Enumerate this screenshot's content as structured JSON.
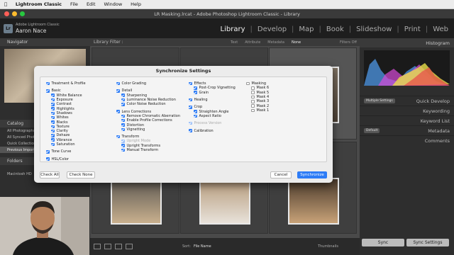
{
  "menubar": {
    "apple": "",
    "items": [
      "Lightroom Classic",
      "File",
      "Edit",
      "Window",
      "Help"
    ]
  },
  "window": {
    "title": "LR Masking.lrcat - Adobe Photoshop Lightroom Classic - Library"
  },
  "identity": {
    "product": "Adobe Lightroom Classic",
    "name": "Aaron Nace"
  },
  "modules": [
    "Library",
    "Develop",
    "Map",
    "Book",
    "Slideshow",
    "Print",
    "Web"
  ],
  "left_panel": {
    "navigator": "Navigator",
    "catalog": "Catalog",
    "catalog_items": [
      "All Photographs",
      "All Synced Photographs",
      "Quick Collection +",
      "Previous Import"
    ],
    "folders": "Folders",
    "drive": "Macintosh HD"
  },
  "filter_bar": {
    "label": "Library Filter :",
    "options": [
      "Text",
      "Attribute",
      "Metadata",
      "None"
    ],
    "filters_off": "Filters Off"
  },
  "right_panel": {
    "histogram": "Histogram",
    "preset": "Multiple Settings",
    "quick_develop": "Quick Develop",
    "keywording": "Keywording",
    "keyword_list": "Keyword List",
    "default": "Default",
    "metadata": "Metadata",
    "comments": "Comments"
  },
  "bottom": {
    "sort_label": "Sort:",
    "sort_value": "File Name",
    "thumbnails": "Thumbnails",
    "sync": "Sync",
    "sync_settings": "Sync Settings"
  },
  "dialog": {
    "title": "Synchronize Settings",
    "col1": [
      {
        "label": "Treatment & Profile",
        "on": true,
        "lvl": 0
      },
      {
        "gap": true
      },
      {
        "label": "Basic",
        "on": true,
        "lvl": 0
      },
      {
        "label": "White Balance",
        "on": true,
        "lvl": 1
      },
      {
        "label": "Exposure",
        "on": true,
        "lvl": 1
      },
      {
        "label": "Contrast",
        "on": true,
        "lvl": 1
      },
      {
        "label": "Highlights",
        "on": true,
        "lvl": 1
      },
      {
        "label": "Shadows",
        "on": true,
        "lvl": 1
      },
      {
        "label": "Whites",
        "on": true,
        "lvl": 1
      },
      {
        "label": "Blacks",
        "on": true,
        "lvl": 1
      },
      {
        "label": "Texture",
        "on": true,
        "lvl": 1
      },
      {
        "label": "Clarity",
        "on": true,
        "lvl": 1
      },
      {
        "label": "Dehaze",
        "on": true,
        "lvl": 1
      },
      {
        "label": "Vibrance",
        "on": true,
        "lvl": 1
      },
      {
        "label": "Saturation",
        "on": true,
        "lvl": 1
      },
      {
        "gap": true
      },
      {
        "label": "Tone Curve",
        "on": true,
        "lvl": 0
      },
      {
        "gap": true
      },
      {
        "label": "HSL/Color",
        "on": true,
        "lvl": 0
      }
    ],
    "col2": [
      {
        "label": "Color Grading",
        "on": true,
        "lvl": 0
      },
      {
        "gap": true
      },
      {
        "label": "Detail",
        "on": true,
        "lvl": 0
      },
      {
        "label": "Sharpening",
        "on": true,
        "lvl": 1
      },
      {
        "label": "Luminance Noise Reduction",
        "on": true,
        "lvl": 1
      },
      {
        "label": "Color Noise Reduction",
        "on": true,
        "lvl": 1
      },
      {
        "gap": true
      },
      {
        "label": "Lens Corrections",
        "on": true,
        "lvl": 0
      },
      {
        "label": "Remove Chromatic Aberration",
        "on": true,
        "lvl": 1
      },
      {
        "label": "Enable Profile Corrections",
        "on": true,
        "lvl": 1
      },
      {
        "label": "Distortion",
        "on": true,
        "lvl": 1
      },
      {
        "label": "Vignetting",
        "on": true,
        "lvl": 1
      },
      {
        "gap": true
      },
      {
        "label": "Transform",
        "on": true,
        "lvl": 0
      },
      {
        "label": "Upright Mode",
        "on": true,
        "lvl": 1,
        "dim": true
      },
      {
        "label": "Upright Transforms",
        "on": true,
        "lvl": 1
      },
      {
        "label": "Manual Transform",
        "on": true,
        "lvl": 1
      }
    ],
    "col3": [
      {
        "label": "Effects",
        "on": true,
        "lvl": 0
      },
      {
        "label": "Post-Crop Vignetting",
        "on": true,
        "lvl": 1
      },
      {
        "label": "Grain",
        "on": true,
        "lvl": 1
      },
      {
        "gap": true
      },
      {
        "label": "Healing",
        "on": true,
        "lvl": 0
      },
      {
        "gap": true
      },
      {
        "label": "Crop",
        "on": true,
        "lvl": 0
      },
      {
        "label": "Straighten Angle",
        "on": true,
        "lvl": 1
      },
      {
        "label": "Aspect Ratio",
        "on": true,
        "lvl": 1
      },
      {
        "gap": true
      },
      {
        "label": "Process Version",
        "on": true,
        "lvl": 0,
        "dim": true
      },
      {
        "gap": true
      },
      {
        "label": "Calibration",
        "on": true,
        "lvl": 0
      }
    ],
    "col4": [
      {
        "label": "Masking",
        "on": false,
        "lvl": 0
      },
      {
        "label": "Mask 6",
        "on": false,
        "lvl": 1
      },
      {
        "label": "Mask 5",
        "on": false,
        "lvl": 1
      },
      {
        "label": "Mask 4",
        "on": false,
        "lvl": 1
      },
      {
        "label": "Mask 3",
        "on": false,
        "lvl": 1
      },
      {
        "label": "Mask 2",
        "on": false,
        "lvl": 1
      },
      {
        "label": "Mask 1",
        "on": false,
        "lvl": 1
      }
    ],
    "buttons": {
      "check_all": "Check All",
      "check_none": "Check None",
      "cancel": "Cancel",
      "synchronize": "Synchronize"
    }
  },
  "colors": {
    "accent": "#2d7cf6",
    "panel": "#2e2e2e",
    "grid": "#4a4a4a"
  }
}
